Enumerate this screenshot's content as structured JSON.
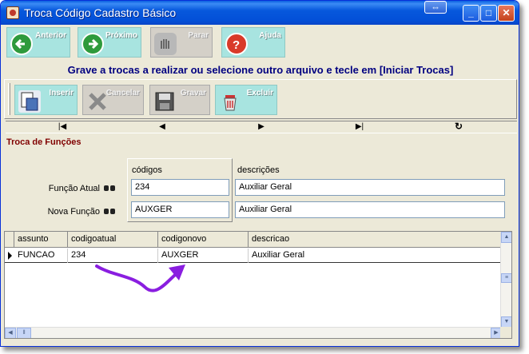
{
  "window": {
    "title": "Troca Código Cadastro Básico",
    "controls": {
      "swap": "⇔",
      "minimize": "_",
      "maximize": "□",
      "close": "✕"
    }
  },
  "nav_buttons": [
    {
      "label": "Anterior",
      "icon": "arrow-left-icon",
      "enabled": true
    },
    {
      "label": "Próximo",
      "icon": "arrow-right-icon",
      "enabled": true
    },
    {
      "label": "Parar",
      "icon": "stop-hand-icon",
      "enabled": false
    },
    {
      "label": "Ajuda",
      "icon": "help-icon",
      "enabled": true
    }
  ],
  "message": "Grave a trocas a realizar ou selecione outro arquivo e tecle em [Iniciar Trocas]",
  "edit_buttons": [
    {
      "label": "Inserir",
      "icon": "insert-document-icon",
      "enabled": true
    },
    {
      "label": "Cancelar",
      "icon": "cancel-x-icon",
      "enabled": false
    },
    {
      "label": "Gravar",
      "icon": "floppy-disk-icon",
      "enabled": false
    },
    {
      "label": "Excluir",
      "icon": "trash-icon",
      "enabled": true
    }
  ],
  "navigator": {
    "first": "|◀",
    "prior": "◀",
    "next": "▶",
    "last": "▶|",
    "refresh": "↻"
  },
  "section_title": "Troca de Funções",
  "form": {
    "col_codigos": "códigos",
    "col_descricoes": "descrições",
    "current_label": "Função Atual",
    "new_label": "Nova Função",
    "current_code": "234",
    "current_desc": "Auxiliar Geral",
    "new_code": "AUXGER",
    "new_desc": "Auxiliar Geral"
  },
  "grid": {
    "columns": [
      "assunto",
      "codigoatual",
      "codigonovo",
      "descricao"
    ],
    "rows": [
      [
        "FUNCAO",
        "234",
        "AUXGER",
        "Auxiliar Geral"
      ]
    ]
  },
  "colors": {
    "accent_arrow": "#8a1ee0",
    "nav_button_bg": "#a8e4e0",
    "message": "#000080",
    "section_title": "#800000"
  }
}
